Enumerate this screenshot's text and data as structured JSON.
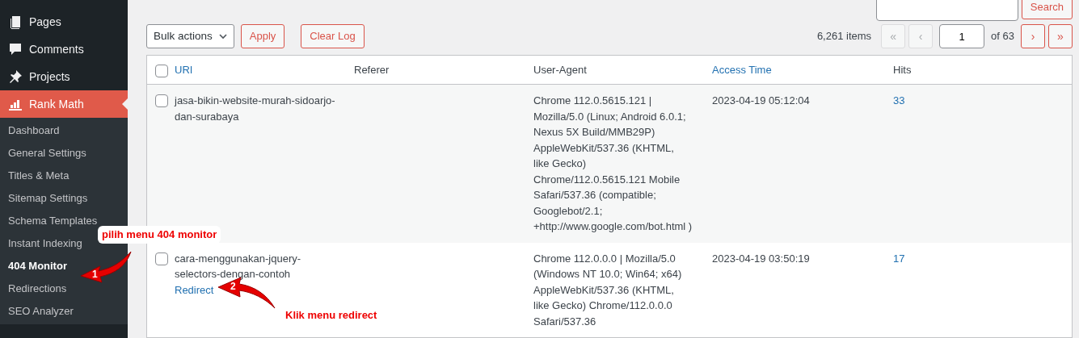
{
  "sidebar": {
    "items": [
      {
        "label": "Pages",
        "selected": false
      },
      {
        "label": "Comments",
        "selected": false
      },
      {
        "label": "Projects",
        "selected": false
      },
      {
        "label": "Rank Math",
        "selected": true
      }
    ],
    "submenu": [
      {
        "label": "Dashboard",
        "selected": false
      },
      {
        "label": "General Settings",
        "selected": false
      },
      {
        "label": "Titles & Meta",
        "selected": false
      },
      {
        "label": "Sitemap Settings",
        "selected": false
      },
      {
        "label": "Schema Templates",
        "selected": false
      },
      {
        "label": "Instant Indexing",
        "selected": false
      },
      {
        "label": "404 Monitor",
        "selected": true
      },
      {
        "label": "Redirections",
        "selected": false
      },
      {
        "label": "SEO Analyzer",
        "selected": false
      }
    ]
  },
  "search": {
    "button": "Search"
  },
  "toolbar": {
    "bulk_actions": "Bulk actions",
    "apply": "Apply",
    "clear_log": "Clear Log"
  },
  "pagination": {
    "count": "6,261 items",
    "first": {
      "label": "«",
      "disabled": true
    },
    "prev": {
      "label": "‹",
      "disabled": true
    },
    "page": "1",
    "of": "of 63",
    "next": {
      "label": "›",
      "disabled": false
    },
    "last": {
      "label": "»",
      "disabled": false
    }
  },
  "table": {
    "select_all": {
      "checked": false
    },
    "columns": [
      {
        "label": "URI",
        "sortable": true
      },
      {
        "label": "Referer",
        "sortable": false
      },
      {
        "label": "User-Agent",
        "sortable": false
      },
      {
        "label": "Access Time",
        "sortable": true
      },
      {
        "label": "Hits",
        "sortable": false
      }
    ],
    "rows": [
      {
        "checked": false,
        "uri": "jasa-bikin-website-murah-sidoarjo-dan-surabaya",
        "user_agent": "Chrome 112.0.5615.121 | Mozilla/5.0 (Linux; Android 6.0.1; Nexus 5X Build/MMB29P) AppleWebKit/537.36 (KHTML, like Gecko) Chrome/112.0.5615.121 Mobile Safari/537.36 (compatible; Googlebot/2.1; +http://www.google.com/bot.html )",
        "access_time": "2023-04-19 05:12:04",
        "hits": "33"
      },
      {
        "checked": false,
        "uri": "cara-menggunakan-jquery-selectors-dengan-contoh",
        "row_actions": [
          "Redirect"
        ],
        "user_agent": "Chrome 112.0.0.0 | Mozilla/5.0 (Windows NT 10.0; Win64; x64) AppleWebKit/537.36 (KHTML, like Gecko) Chrome/112.0.0.0 Safari/537.36",
        "access_time": "2023-04-19 03:50:19",
        "hits": "17"
      }
    ]
  },
  "annotations": [
    {
      "number": "1",
      "label": "pilih menu 404 monitor"
    },
    {
      "number": "2",
      "label": "Klik menu redirect"
    }
  ]
}
